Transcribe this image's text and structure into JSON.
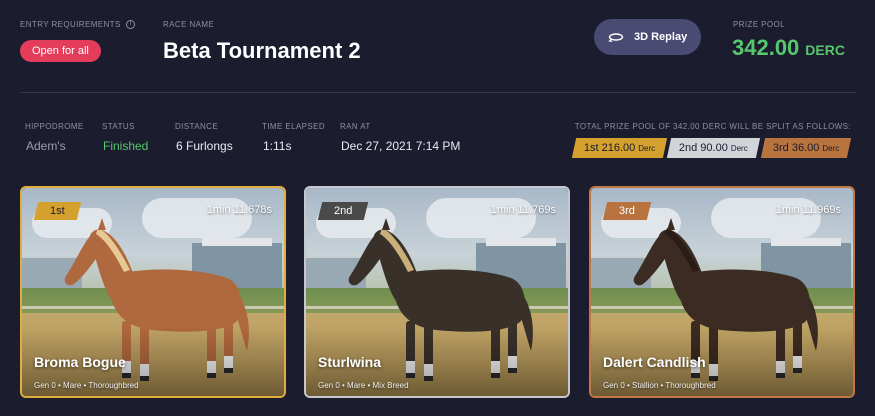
{
  "header": {
    "entry_label": "ENTRY REQUIREMENTS",
    "entry_value": "Open for all",
    "race_name_label": "RACE NAME",
    "race_name": "Beta Tournament 2",
    "replay_button": "3D Replay",
    "prize_label": "PRIZE POOL",
    "prize_value": "342.00",
    "prize_unit": "DERC"
  },
  "meta": {
    "hippodrome_label": "HIPPODROME",
    "hippodrome": "Adem's",
    "status_label": "STATUS",
    "status": "Finished",
    "distance_label": "DISTANCE",
    "distance": "6 Furlongs",
    "elapsed_label": "TIME ELAPSED",
    "elapsed": "1:11s",
    "ran_at_label": "RAN AT",
    "ran_at": "Dec 27, 2021 7:14 PM"
  },
  "split": {
    "caption": "TOTAL PRIZE POOL OF 342.00 DERC WILL BE SPLIT AS FOLLOWS:",
    "first": {
      "text": "1st 216.00",
      "unit": "Derc"
    },
    "second": {
      "text": "2nd 90.00",
      "unit": "Derc"
    },
    "third": {
      "text": "3rd 36.00",
      "unit": "Derc"
    }
  },
  "colors": {
    "gold": "#d4a12e",
    "silver": "#d3d4da",
    "bronze": "#b8733e",
    "accent_red": "#e43d5b",
    "prize_green": "#56c76d"
  },
  "cards": [
    {
      "place": "1st",
      "time": "1min 11.678s",
      "name": "Broma Bogue",
      "info": "Gen 0 • Mare • Thoroughbred",
      "coat": "chestnut"
    },
    {
      "place": "2nd",
      "time": "1min 11.769s",
      "name": "Sturlwina",
      "info": "Gen 0 • Mare • Mix Breed",
      "coat": "dark-brown"
    },
    {
      "place": "3rd",
      "time": "1min 11.969s",
      "name": "Dalert Candlish",
      "info": "Gen 0 • Stallion • Thoroughbred",
      "coat": "dark-bay"
    }
  ]
}
